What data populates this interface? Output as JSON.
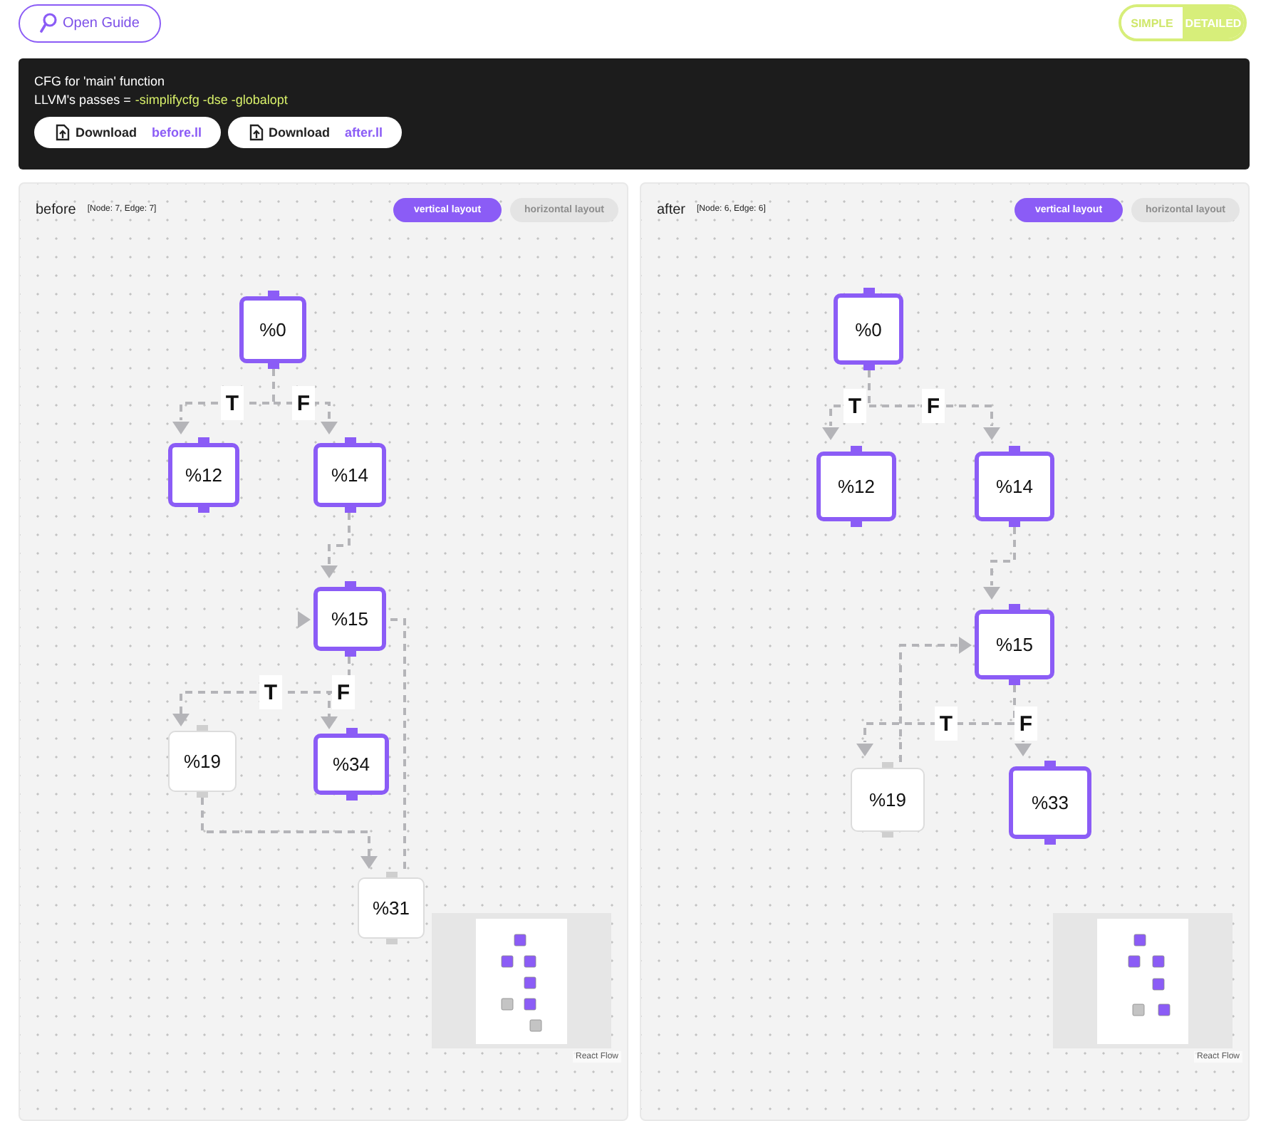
{
  "header": {
    "guide_button": "Open Guide",
    "view_toggle": [
      {
        "label": "SIMPLE",
        "selected": false
      },
      {
        "label": "DETAILED",
        "selected": true
      }
    ]
  },
  "info": {
    "title": "CFG for 'main' function",
    "passes_label": "LLVM's passes =",
    "passes": "-simplifycfg -dse -globalopt",
    "downloads": [
      {
        "prefix": "Download",
        "file": "before.ll"
      },
      {
        "prefix": "Download",
        "file": "after.ll"
      }
    ]
  },
  "graphs": [
    {
      "title": "before",
      "stats": "[Node: 7, Edge: 7]",
      "layout_buttons": [
        {
          "label": "vertical layout",
          "selected": true
        },
        {
          "label": "horizontal layout",
          "selected": false
        }
      ],
      "nodes": [
        {
          "label": "%0",
          "highlighted": true
        },
        {
          "label": "%12",
          "highlighted": true
        },
        {
          "label": "%14",
          "highlighted": true
        },
        {
          "label": "%15",
          "highlighted": true
        },
        {
          "label": "%19",
          "highlighted": false
        },
        {
          "label": "%34",
          "highlighted": true
        },
        {
          "label": "%31",
          "highlighted": false
        }
      ],
      "edge_labels": [
        "T",
        "F",
        "T",
        "F"
      ],
      "attribution": "React Flow"
    },
    {
      "title": "after",
      "stats": "[Node: 6, Edge: 6]",
      "layout_buttons": [
        {
          "label": "vertical layout",
          "selected": true
        },
        {
          "label": "horizontal layout",
          "selected": false
        }
      ],
      "nodes": [
        {
          "label": "%0",
          "highlighted": true
        },
        {
          "label": "%12",
          "highlighted": true
        },
        {
          "label": "%14",
          "highlighted": true
        },
        {
          "label": "%15",
          "highlighted": true
        },
        {
          "label": "%19",
          "highlighted": false
        },
        {
          "label": "%33",
          "highlighted": true
        }
      ],
      "edge_labels": [
        "T",
        "F",
        "T",
        "F"
      ],
      "attribution": "React Flow"
    }
  ]
}
